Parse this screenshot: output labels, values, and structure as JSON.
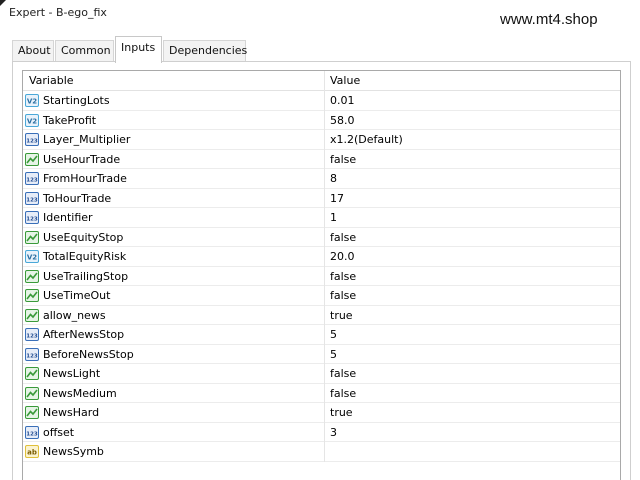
{
  "window": {
    "title": "Expert - B-ego_fix",
    "watermark": "www.mt4.shop"
  },
  "tabs": [
    {
      "label": "About",
      "active": false
    },
    {
      "label": "Common",
      "active": false
    },
    {
      "label": "Inputs",
      "active": true
    },
    {
      "label": "Dependencies",
      "active": false
    }
  ],
  "table": {
    "columns": {
      "variable": "Variable",
      "value": "Value"
    },
    "rows": [
      {
        "name": "StartingLots",
        "value": "0.01",
        "icon": "double-icon"
      },
      {
        "name": "TakeProfit",
        "value": "58.0",
        "icon": "double-icon"
      },
      {
        "name": "Layer_Multiplier",
        "value": "x1.2(Default)",
        "icon": "integer-icon"
      },
      {
        "name": "UseHourTrade",
        "value": "false",
        "icon": "bool-icon"
      },
      {
        "name": "FromHourTrade",
        "value": "8",
        "icon": "integer-icon"
      },
      {
        "name": "ToHourTrade",
        "value": "17",
        "icon": "integer-icon"
      },
      {
        "name": "Identifier",
        "value": "1",
        "icon": "integer-icon"
      },
      {
        "name": "UseEquityStop",
        "value": "false",
        "icon": "bool-icon"
      },
      {
        "name": "TotalEquityRisk",
        "value": "20.0",
        "icon": "double-icon"
      },
      {
        "name": "UseTrailingStop",
        "value": "false",
        "icon": "bool-icon"
      },
      {
        "name": "UseTimeOut",
        "value": "false",
        "icon": "bool-icon"
      },
      {
        "name": "allow_news",
        "value": "true",
        "icon": "bool-icon"
      },
      {
        "name": "AfterNewsStop",
        "value": "5",
        "icon": "integer-icon"
      },
      {
        "name": "BeforeNewsStop",
        "value": "5",
        "icon": "integer-icon"
      },
      {
        "name": "NewsLight",
        "value": "false",
        "icon": "bool-icon"
      },
      {
        "name": "NewsMedium",
        "value": "false",
        "icon": "bool-icon"
      },
      {
        "name": "NewsHard",
        "value": "true",
        "icon": "bool-icon"
      },
      {
        "name": "offset",
        "value": "3",
        "icon": "integer-icon"
      },
      {
        "name": "NewsSymb",
        "value": "",
        "icon": "string-icon"
      }
    ]
  },
  "icon_labels": {
    "double-icon": "V2",
    "integer-icon": "123",
    "string-icon": "ab"
  },
  "colors": {
    "double_icon": "#4aa8d8",
    "integer_icon": "#3a6fb8",
    "bool_icon": "#3a9a3a",
    "string_icon": "#e0c03a"
  }
}
